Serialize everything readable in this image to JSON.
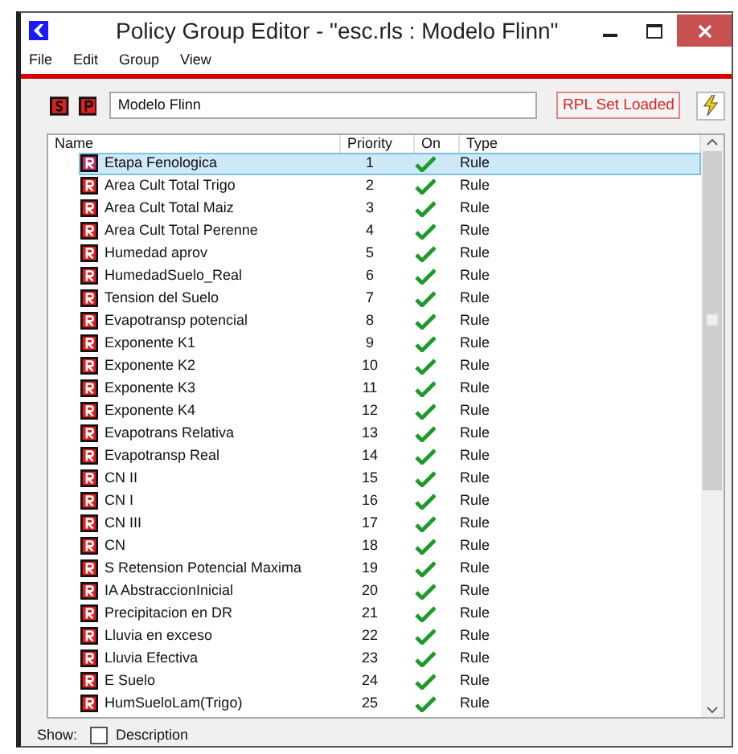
{
  "window": {
    "title": "Policy Group Editor - \"esc.rls : Modelo Flinn\""
  },
  "menu": [
    "File",
    "Edit",
    "Group",
    "View"
  ],
  "toolbar": {
    "set_name": "Modelo Flinn",
    "status": "RPL Set Loaded"
  },
  "table": {
    "columns": [
      "Name",
      "Priority",
      "On",
      "Type"
    ],
    "rows": [
      {
        "name": "Etapa Fenologica",
        "priority": "1",
        "on": true,
        "type": "Rule",
        "selected": true
      },
      {
        "name": "Area Cult Total Trigo",
        "priority": "2",
        "on": true,
        "type": "Rule",
        "selected": false
      },
      {
        "name": "Area Cult Total Maiz",
        "priority": "3",
        "on": true,
        "type": "Rule",
        "selected": false
      },
      {
        "name": "Area Cult Total Perenne",
        "priority": "4",
        "on": true,
        "type": "Rule",
        "selected": false
      },
      {
        "name": "Humedad aprov",
        "priority": "5",
        "on": true,
        "type": "Rule",
        "selected": false
      },
      {
        "name": "HumedadSuelo_Real",
        "priority": "6",
        "on": true,
        "type": "Rule",
        "selected": false
      },
      {
        "name": "Tension del Suelo",
        "priority": "7",
        "on": true,
        "type": "Rule",
        "selected": false
      },
      {
        "name": "Evapotransp potencial",
        "priority": "8",
        "on": true,
        "type": "Rule",
        "selected": false
      },
      {
        "name": "Exponente K1",
        "priority": "9",
        "on": true,
        "type": "Rule",
        "selected": false
      },
      {
        "name": "Exponente K2",
        "priority": "10",
        "on": true,
        "type": "Rule",
        "selected": false
      },
      {
        "name": "Exponente K3",
        "priority": "11",
        "on": true,
        "type": "Rule",
        "selected": false
      },
      {
        "name": "Exponente K4",
        "priority": "12",
        "on": true,
        "type": "Rule",
        "selected": false
      },
      {
        "name": "Evapotrans Relativa",
        "priority": "13",
        "on": true,
        "type": "Rule",
        "selected": false
      },
      {
        "name": "Evapotransp Real",
        "priority": "14",
        "on": true,
        "type": "Rule",
        "selected": false
      },
      {
        "name": "CN II",
        "priority": "15",
        "on": true,
        "type": "Rule",
        "selected": false
      },
      {
        "name": "CN I",
        "priority": "16",
        "on": true,
        "type": "Rule",
        "selected": false
      },
      {
        "name": "CN III",
        "priority": "17",
        "on": true,
        "type": "Rule",
        "selected": false
      },
      {
        "name": "CN",
        "priority": "18",
        "on": true,
        "type": "Rule",
        "selected": false
      },
      {
        "name": "S Retension Potencial Maxima",
        "priority": "19",
        "on": true,
        "type": "Rule",
        "selected": false
      },
      {
        "name": "IA AbstraccionInicial",
        "priority": "20",
        "on": true,
        "type": "Rule",
        "selected": false
      },
      {
        "name": "Precipitacion en DR",
        "priority": "21",
        "on": true,
        "type": "Rule",
        "selected": false
      },
      {
        "name": "Lluvia en exceso",
        "priority": "22",
        "on": true,
        "type": "Rule",
        "selected": false
      },
      {
        "name": "Lluvia Efectiva",
        "priority": "23",
        "on": true,
        "type": "Rule",
        "selected": false
      },
      {
        "name": "E Suelo",
        "priority": "24",
        "on": true,
        "type": "Rule",
        "selected": false
      },
      {
        "name": "HumSueloLam(Trigo)",
        "priority": "25",
        "on": true,
        "type": "Rule",
        "selected": false
      }
    ]
  },
  "footer": {
    "label": "Show:",
    "option": {
      "label": "Description",
      "checked": false
    }
  }
}
